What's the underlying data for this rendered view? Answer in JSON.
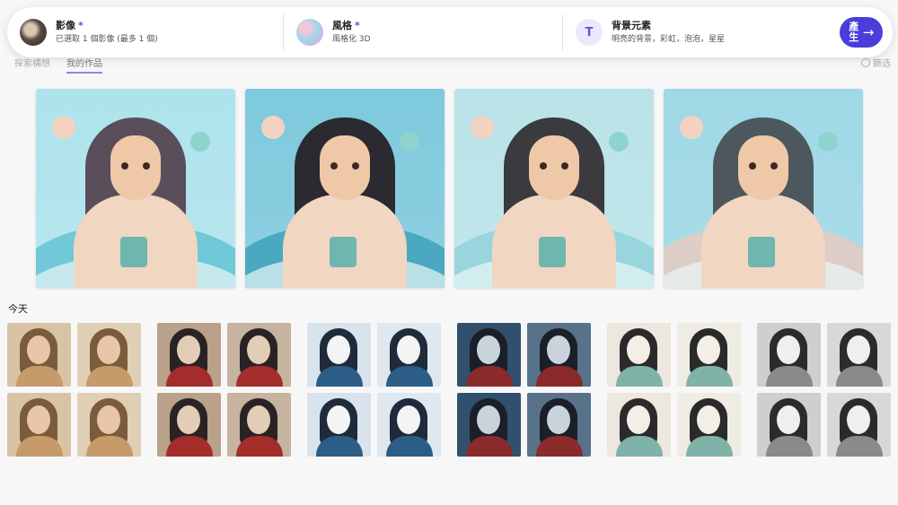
{
  "topbar": {
    "image": {
      "title": "影像",
      "required_mark": "*",
      "subtitle": "已選取 1 個影像 (最多 1 個)"
    },
    "style": {
      "title": "風格",
      "required_mark": "*",
      "subtitle": "風格化 3D"
    },
    "background": {
      "title": "背景元素",
      "icon_text": "T",
      "subtitle": "明亮的背景，彩虹，泡泡，星星"
    },
    "generate": {
      "label": "產生",
      "icon": "arrow-right-icon"
    }
  },
  "tabs": [
    {
      "label": "探索構想",
      "active": false
    },
    {
      "label": "我的作品",
      "active": true
    }
  ],
  "tab_right": {
    "label": "篩选"
  },
  "featured": [
    {
      "sky": "#aee3ec",
      "wave": "#5fc1d2",
      "hair": "#5a4e5a"
    },
    {
      "sky": "#7ec9dd",
      "wave": "#3a9fb8",
      "hair": "#2c2a31"
    },
    {
      "sky": "#b9e3e8",
      "wave": "#8fd1d8",
      "hair": "#3b3a3e"
    },
    {
      "sky": "#9fd8e6",
      "wave": "#e8c9bd",
      "hair": "#4c575e"
    }
  ],
  "today": {
    "label": "今天",
    "groups": [
      {
        "style": "cubist-warm",
        "bg": "#d8c4a4",
        "hair": "#7a5b3c",
        "face": "#e7c7a8",
        "body": "#c79a6a"
      },
      {
        "style": "cubist-red",
        "bg": "#b9a18a",
        "hair": "#2a2324",
        "face": "#e3cdb7",
        "body": "#a32d2a"
      },
      {
        "style": "ink-blue",
        "bg": "#d9e3ec",
        "hair": "#1f2a3a",
        "face": "#f4f4f4",
        "body": "#2c5d86"
      },
      {
        "style": "dark-blue",
        "bg": "#30506e",
        "hair": "#1a1f2a",
        "face": "#c9d3dc",
        "body": "#8a2a2a"
      },
      {
        "style": "doodle",
        "bg": "#ece8df",
        "hair": "#2a2a2a",
        "face": "#f3efe6",
        "body": "#7fb3a7"
      },
      {
        "style": "sketch-bw",
        "bg": "#cfcfcf",
        "hair": "#2b2b2b",
        "face": "#efefef",
        "body": "#8a8a8a"
      }
    ]
  }
}
